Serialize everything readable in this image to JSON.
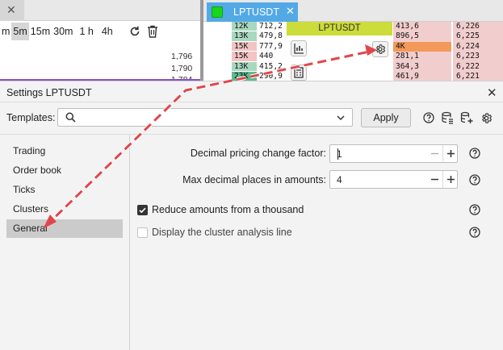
{
  "background_app": {
    "left_panel": {
      "timeframes": [
        "m",
        "5m",
        "15m",
        "30m",
        "1 h",
        "4h"
      ],
      "active_timeframe_index": 1,
      "price_labels": [
        "1,796",
        "1,790",
        "1,784"
      ]
    },
    "right_panel": {
      "tab_title": "LPTUSDT",
      "tab_color": "#19d61c",
      "symbol_header": "LPTUSDT",
      "volumes": [
        "12K",
        "13K",
        "15K",
        "15K",
        "13K",
        "23K"
      ],
      "volume_colors": [
        "#a8d8c0",
        "#a8d8c0",
        "#f2c4c4",
        "#f2c4c4",
        "#a8d8c0",
        "#5fb88f"
      ],
      "bid_prices": [
        "712,2",
        "479,8",
        "777,9",
        "440",
        "415,2",
        "290,9"
      ],
      "ask_volumes": [
        "413,6",
        "896,5",
        "4K",
        "281,1",
        "364,3",
        "461,9"
      ],
      "ask_prices": [
        "6,226",
        "6,225",
        "6,224",
        "6,223",
        "6,222",
        "6,221"
      ]
    }
  },
  "dialog": {
    "title": "Settings LPTUSDT",
    "templates": {
      "label": "Templates:",
      "value": "",
      "apply_label": "Apply"
    },
    "nav": [
      {
        "label": "Trading"
      },
      {
        "label": "Order book"
      },
      {
        "label": "Ticks"
      },
      {
        "label": "Clusters"
      },
      {
        "label": "General"
      }
    ],
    "selected_nav_index": 4,
    "settings": {
      "decimal_factor": {
        "label": "Decimal pricing change factor:",
        "value": "1"
      },
      "max_decimal": {
        "label": "Max decimal places in amounts:",
        "value": "4"
      },
      "reduce_amounts": {
        "label": "Reduce amounts from a thousand",
        "checked": true
      },
      "cluster_line": {
        "label": "Display the cluster analysis line",
        "checked": false
      }
    }
  },
  "colors": {
    "accent_tab": "#52a9e6",
    "symbol_header": "#ccdc3a",
    "annotation_arrow": "#e0474c"
  }
}
